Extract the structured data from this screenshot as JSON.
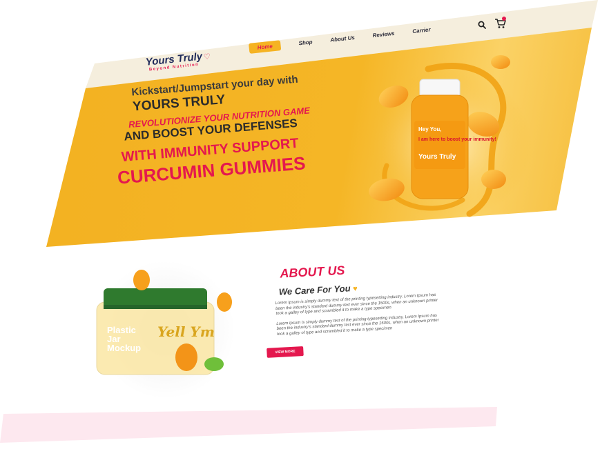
{
  "header": {
    "logo": {
      "name": "Yours Truly",
      "tagline": "Beyond Nutrition"
    },
    "nav": [
      {
        "label": "Home",
        "active": true
      },
      {
        "label": "Shop",
        "active": false
      },
      {
        "label": "About Us",
        "active": false
      },
      {
        "label": "Reviews",
        "active": false
      },
      {
        "label": "Carrier",
        "active": false
      }
    ],
    "icons": [
      "search-icon",
      "cart-icon"
    ]
  },
  "hero": {
    "line1": "Kickstart/Jumpstart your day with",
    "line2": "YOURS TRULY",
    "line3": "REVOLUTIONIZE YOUR NUTRITION GAME",
    "line4": "AND BOOST YOUR DEFENSES",
    "line5": "WITH IMMUNITY SUPPORT",
    "line6": "CURCUMIN GUMMIES",
    "product_label": {
      "greeting": "Hey You,",
      "message": "I am here to boost your immunity!",
      "brand": "Yours Truly"
    }
  },
  "jar_mockup": {
    "title_line1": "Plastic",
    "title_line2": "Jar",
    "title_line3": "Mockup",
    "script_text": "Yell Ym"
  },
  "about": {
    "title": "ABOUT US",
    "subtitle": "We Care For You",
    "paragraph1": "Lorem Ipsum is simply dummy text of the printing typesetting industry. Lorem Ipsum has been the industry's standard dummy text ever since the 1500s, when an unknown printer took a galley of type and scrambled it to make a type specimen",
    "paragraph2": "Lorem Ipsum is simply dummy text of the printing typesetting industry. Lorem Ipsum has been the industry's standard dummy text ever since the 1500s, when an unknown printer took a galley of type and scrambled it to make a type specimen",
    "button": "VIEW MORE"
  },
  "colors": {
    "brand_red": "#e4184e",
    "brand_yellow": "#f5b323",
    "header_bg": "#f5eedd",
    "dark_text": "#2b2b2b"
  }
}
